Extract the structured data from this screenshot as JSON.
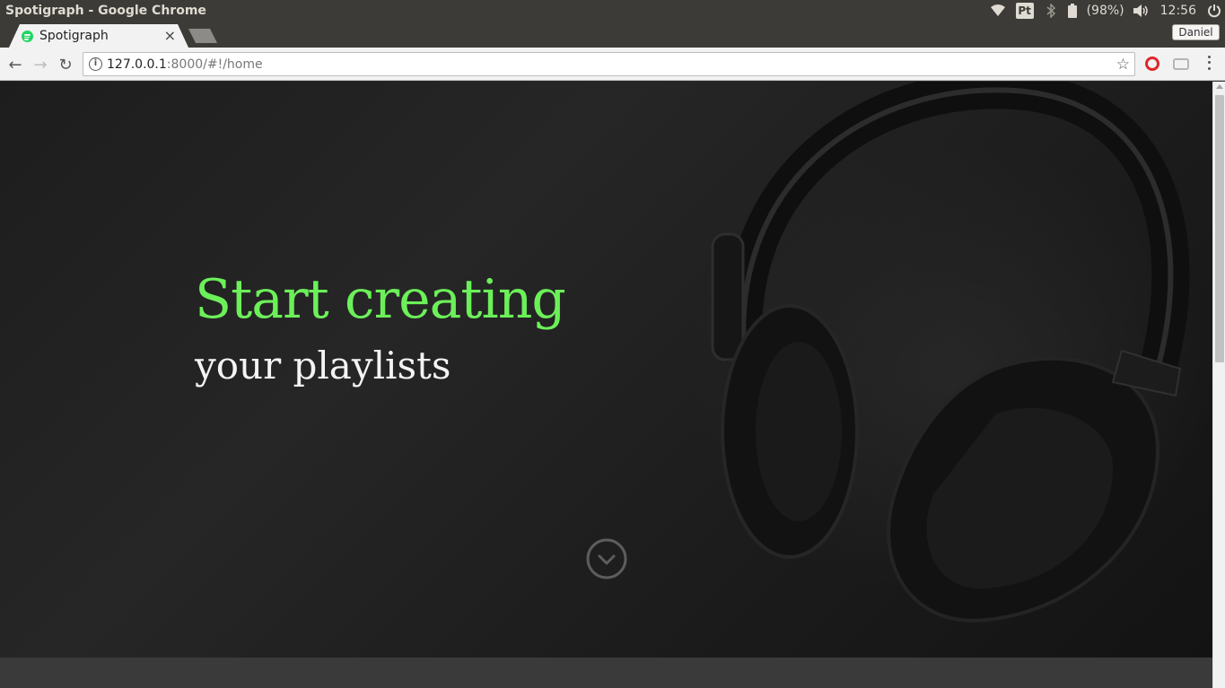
{
  "os": {
    "window_title": "Spotigraph - Google Chrome",
    "keyboard_indicator": "Pt",
    "battery_text": "(98%)",
    "clock": "12:56"
  },
  "browser": {
    "tab_title": "Spotigraph",
    "tab_close": "×",
    "profile_name": "Daniel",
    "url_host": "127.0.0.1",
    "url_rest": ":8000/#!/home",
    "back_glyph": "←",
    "forward_glyph": "→",
    "reload_glyph": "↻",
    "star_glyph": "☆"
  },
  "page": {
    "hero_title": "Start creating",
    "hero_subtitle": "your playlists"
  },
  "colors": {
    "accent_green": "#6cf059",
    "spotify_green": "#1ed760",
    "hero_bg": "#1f1f1f"
  },
  "icons": {
    "scroll_down": "chevron-down-circle-icon",
    "wifi": "wifi-icon",
    "bluetooth": "bluetooth-icon",
    "battery": "battery-icon",
    "volume": "volume-icon",
    "power": "power-icon"
  }
}
